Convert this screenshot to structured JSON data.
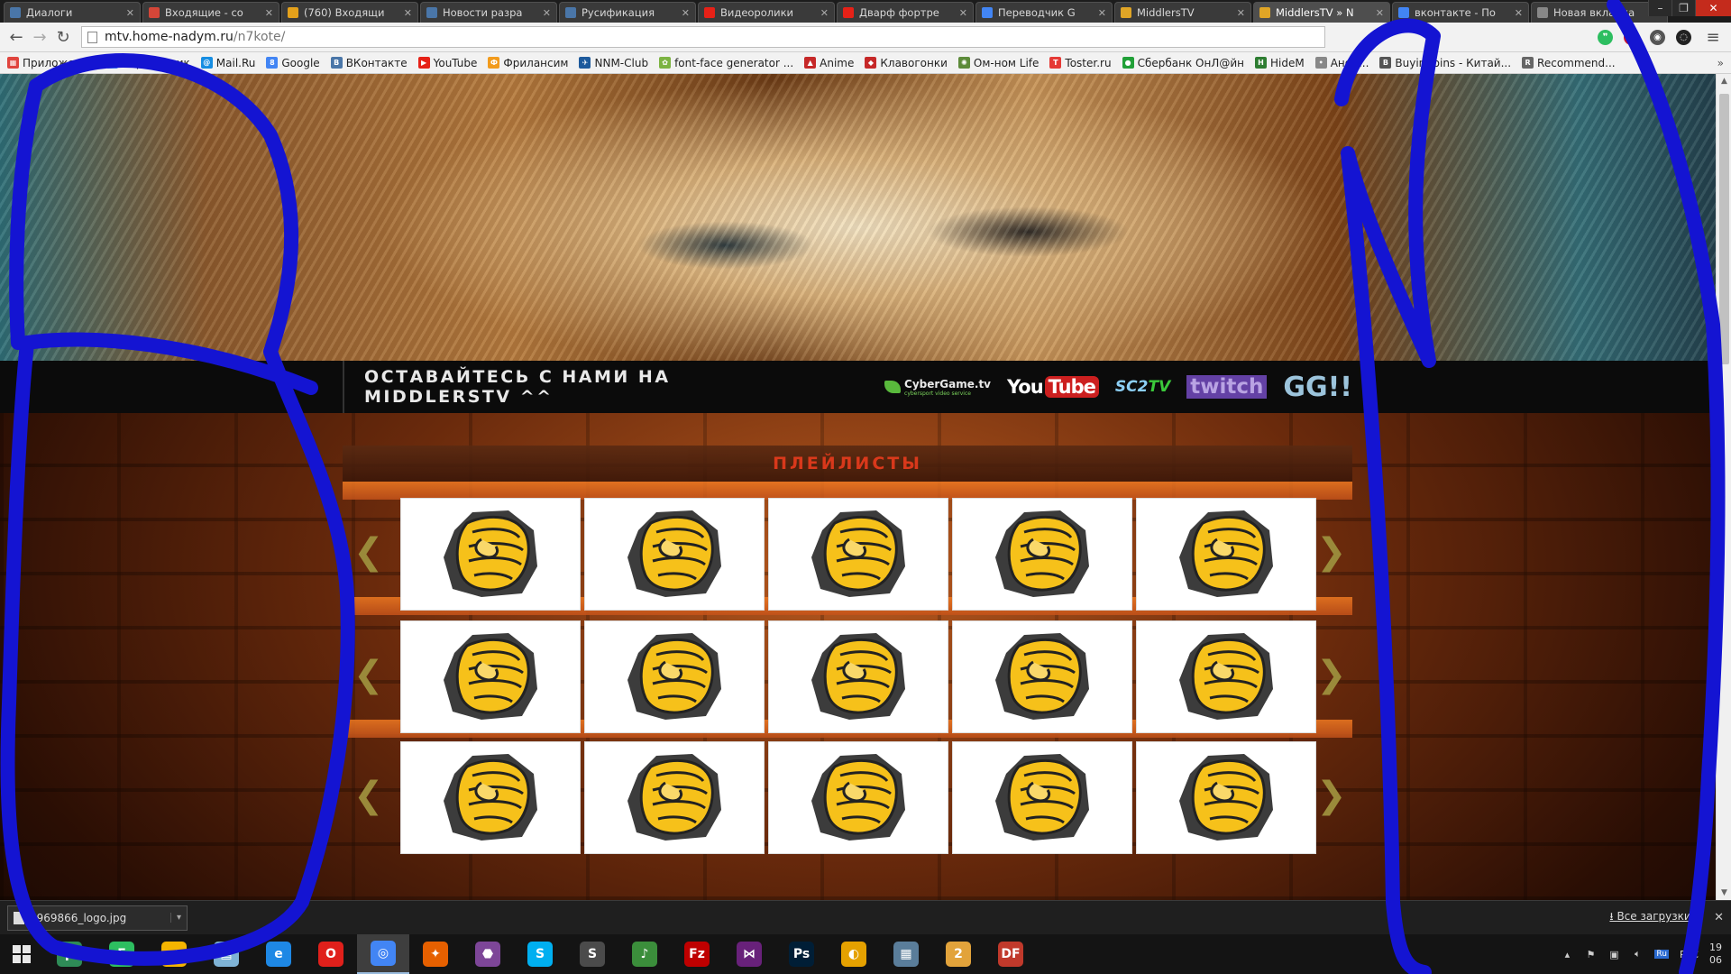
{
  "browser": {
    "tabs": [
      {
        "title": "Диалоги",
        "favicon_color": "#4a76a8",
        "favicon_glyph": "vk-icon"
      },
      {
        "title": "Входящие - со",
        "favicon_color": "#d44638",
        "favicon_glyph": "gmail-icon"
      },
      {
        "title": "(760) Входящи",
        "favicon_color": "#e4a11b",
        "favicon_glyph": "mail-at-icon"
      },
      {
        "title": "Новости разра",
        "favicon_color": "#4a76a8",
        "favicon_glyph": "b-icon"
      },
      {
        "title": "Русификация",
        "favicon_color": "#4a76a8",
        "favicon_glyph": "b-icon"
      },
      {
        "title": "Видеоролики",
        "favicon_color": "#e62117",
        "favicon_glyph": "youtube-icon"
      },
      {
        "title": "Дварф фортре",
        "favicon_color": "#e62117",
        "favicon_glyph": "youtube-icon"
      },
      {
        "title": "Переводчик G",
        "favicon_color": "#4285f4",
        "favicon_glyph": "translate-icon"
      },
      {
        "title": "MiddlersTV",
        "favicon_color": "#e0a526",
        "favicon_glyph": "m-icon"
      },
      {
        "title": "MiddlersTV » N",
        "favicon_color": "#e0a526",
        "favicon_glyph": "m-icon",
        "active": true
      },
      {
        "title": "вконтакте - По",
        "favicon_color": "#4285f4",
        "favicon_glyph": "google-icon"
      },
      {
        "title": "Новая вкладка",
        "favicon_color": "#888888",
        "favicon_glyph": "blank-icon"
      }
    ],
    "window_controls": [
      "–",
      "❐",
      "✕"
    ],
    "toolbar": {
      "back": "←",
      "forward": "→",
      "reload": "↻",
      "url_host": "mtv.home-nadym.ru",
      "url_path": "/n7kote/",
      "menu": "≡"
    },
    "extensions": [
      {
        "name": "evernote-icon",
        "color": "#2dbe60",
        "glyph": "❞"
      },
      {
        "name": "adblock-icon",
        "color": "#c8102e",
        "glyph": "!"
      },
      {
        "name": "screenshot-icon",
        "color": "#555555",
        "glyph": "◉"
      },
      {
        "name": "hidden-icon",
        "color": "#222222",
        "glyph": "◌"
      }
    ],
    "bookmarks": [
      {
        "label": "Приложения",
        "color": "#e0443e",
        "glyph": "▦"
      },
      {
        "label": "Переводчик",
        "color": "#4285f4",
        "glyph": "G"
      },
      {
        "label": "Mail.Ru",
        "color": "#168de2",
        "glyph": "@"
      },
      {
        "label": "Google",
        "color": "#4285f4",
        "glyph": "8"
      },
      {
        "label": "ВКонтакте",
        "color": "#4a76a8",
        "glyph": "B"
      },
      {
        "label": "YouTube",
        "color": "#e62117",
        "glyph": "▶"
      },
      {
        "label": "Фрилансим",
        "color": "#f29b1d",
        "glyph": "Ф"
      },
      {
        "label": "NNM-Club",
        "color": "#1d5a9c",
        "glyph": "✈"
      },
      {
        "label": "font-face generator ...",
        "color": "#7cb342",
        "glyph": "✿"
      },
      {
        "label": "Anime",
        "color": "#c62828",
        "glyph": "▲"
      },
      {
        "label": "Клавогонки",
        "color": "#c62828",
        "glyph": "◆"
      },
      {
        "label": "Ом-ном Life",
        "color": "#5d8b3a",
        "glyph": "✺"
      },
      {
        "label": "Toster.ru",
        "color": "#e53935",
        "glyph": "T"
      },
      {
        "label": "Сбербанк ОнЛ@йн",
        "color": "#21a038",
        "glyph": "●"
      },
      {
        "label": "HideM",
        "color": "#2e7d32",
        "glyph": "H"
      },
      {
        "label": "Анон...",
        "color": "#888888",
        "glyph": "•"
      },
      {
        "label": "BuyinCoins - Китай...",
        "color": "#555555",
        "glyph": "B"
      },
      {
        "label": "Recommend...",
        "color": "#666666",
        "glyph": "R"
      }
    ],
    "bookmarks_more": "»"
  },
  "page": {
    "navbar_text": "ОСТАВАЙТЕСЬ С НАМИ НА MIDDLERSTV ^^",
    "partners": {
      "cybergame": "CyberGame.tv",
      "cybergame_sub": "cybersport video service",
      "youtube_a": "You",
      "youtube_b": "Tube",
      "sc2_a": "SC2",
      "sc2_b": "TV",
      "twitch": "twitch",
      "gg": "GG!!"
    },
    "section_title": "ПЛЕЙЛИСТЫ",
    "arrow_left": "❮",
    "arrow_right": "❯",
    "thumb_icon": "clenched-fist-icon"
  },
  "downloads": {
    "file": "4969866_logo.jpg",
    "show_all": "Все загрузки...",
    "close": "✕"
  },
  "taskbar": {
    "apps": [
      {
        "name": "utorrent-icon",
        "color": "#2e8b57",
        "glyph": "µ"
      },
      {
        "name": "evernote-icon",
        "color": "#2dbe60",
        "glyph": "E"
      },
      {
        "name": "norton-icon",
        "color": "#f4b400",
        "glyph": "✓"
      },
      {
        "name": "files-icon",
        "color": "#7fb3d5",
        "glyph": "▤"
      },
      {
        "name": "ie-icon",
        "color": "#1e88e5",
        "glyph": "e"
      },
      {
        "name": "opera-icon",
        "color": "#e0201b",
        "glyph": "O"
      },
      {
        "name": "chrome-icon",
        "color": "#4285f4",
        "glyph": "◎",
        "active": true
      },
      {
        "name": "firefox-icon",
        "color": "#e66000",
        "glyph": "✦"
      },
      {
        "name": "tor-icon",
        "color": "#7d4698",
        "glyph": "⬣"
      },
      {
        "name": "skype-icon",
        "color": "#00aff0",
        "glyph": "S"
      },
      {
        "name": "sublime-icon",
        "color": "#4b4b4b",
        "glyph": "S"
      },
      {
        "name": "winamp-icon",
        "color": "#3b8e3b",
        "glyph": "♪"
      },
      {
        "name": "filezilla-icon",
        "color": "#bf0000",
        "glyph": "Fz"
      },
      {
        "name": "visual-studio-icon",
        "color": "#68217a",
        "glyph": "⋈"
      },
      {
        "name": "photoshop-icon",
        "color": "#001e36",
        "glyph": "Ps"
      },
      {
        "name": "color-picker-icon",
        "color": "#e5a100",
        "glyph": "◐"
      },
      {
        "name": "calculator-icon",
        "color": "#5a7d9a",
        "glyph": "▦"
      },
      {
        "name": "paint-icon",
        "color": "#e2a33b",
        "glyph": "2"
      },
      {
        "name": "dwarf-fortress-icon",
        "color": "#c0392b",
        "glyph": "DF"
      }
    ],
    "tray": {
      "lang_badge": "Ru",
      "lang": "РУС",
      "time": "19",
      "date": "06"
    }
  },
  "colors": {
    "annotation_marker": "#1414d2",
    "section_title": "#e2381c",
    "page_background": "#6a2a0c"
  }
}
